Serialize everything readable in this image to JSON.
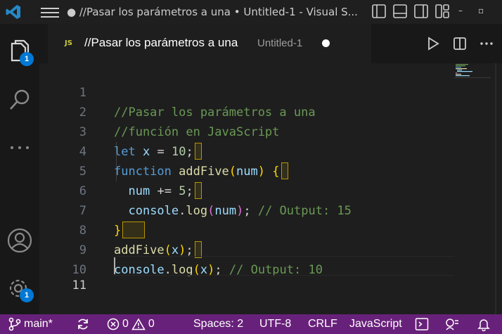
{
  "window": {
    "title": "● //Pasar los parámetros a una • Untitled-1 - Visual S..."
  },
  "activity_bar": {
    "explorer_badge": "1",
    "settings_badge": "1"
  },
  "tab": {
    "icon_text": "JS",
    "title": "//Pasar los parámetros a una",
    "description": "Untitled-1"
  },
  "editor": {
    "line_numbers": [
      "1",
      "2",
      "3",
      "4",
      "5",
      "6",
      "7",
      "8",
      "9",
      "10",
      "11"
    ],
    "lines": [
      "//Pasar los parámetros a una",
      "//función en JavaScript",
      "let x = 10;",
      "function addFive(num) {",
      "  num += 5;",
      "  console.log(num); // Output: 15",
      "}",
      "addFive(x);",
      "console.log(x); // Output: 10",
      "",
      ""
    ],
    "active_line": 11
  },
  "status_bar": {
    "branch": "main*",
    "errors": "0",
    "warnings": "0",
    "spaces": "Spaces: 2",
    "encoding": "UTF-8",
    "eol": "CRLF",
    "language": "JavaScript"
  },
  "colors": {
    "status_bar": "#68217a",
    "badge": "#0078d4",
    "comment": "#6a9955",
    "keyword": "#569cd6",
    "variable": "#9cdcfe",
    "function": "#dcdcaa",
    "number": "#b5cea8"
  }
}
